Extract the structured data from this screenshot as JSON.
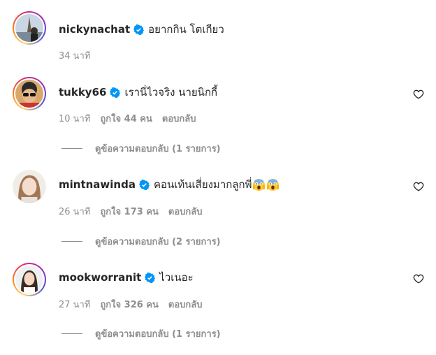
{
  "comments": [
    {
      "username": "nickynachat",
      "text": "อยากกิน โตเกียว",
      "time": "34 นาที",
      "likes": "",
      "reply": "",
      "view_replies": ""
    },
    {
      "username": "tukky66",
      "text": "เรานี่ไวจริง นายนิกกี้",
      "time": "10 นาที",
      "likes": "ถูกใจ 44 คน",
      "reply": "ตอบกลับ",
      "view_replies": "ดูข้อความตอบกลับ (1 รายการ)"
    },
    {
      "username": "mintnawinda",
      "text": "คอนเท้นเสี่ยงมากลูกพี่",
      "emoji": [
        "screaming-face-emoji",
        "screaming-face-emoji"
      ],
      "time": "26 นาที",
      "likes": "ถูกใจ 173 คน",
      "reply": "ตอบกลับ",
      "view_replies": "ดูข้อความตอบกลับ (2 รายการ)"
    },
    {
      "username": "mookworranit",
      "text": "ไวเนอะ",
      "time": "27 นาที",
      "likes": "ถูกใจ 326 คน",
      "reply": "ตอบกลับ",
      "view_replies": "ดูข้อความตอบกลับ (1 รายการ)"
    }
  ],
  "icons": {
    "verified": "verified-badge-icon",
    "like": "heart-outline-icon"
  },
  "colors": {
    "verified_blue": "#0095f6",
    "muted_text": "#8e8e8e",
    "primary_text": "#262626"
  }
}
